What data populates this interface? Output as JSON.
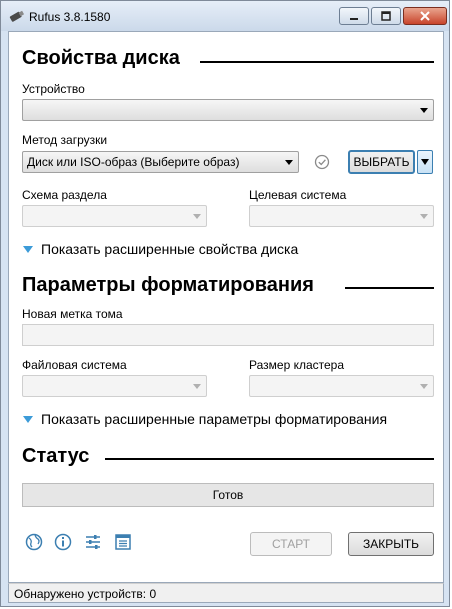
{
  "window": {
    "title": "Rufus 3.8.1580"
  },
  "drive_properties": {
    "heading": "Свойства диска",
    "device_label": "Устройство",
    "device_value": "",
    "boot_method_label": "Метод загрузки",
    "boot_method_value": "Диск или ISO-образ (Выберите образ)",
    "select_button": "ВЫБРАТЬ",
    "partition_scheme_label": "Схема раздела",
    "target_system_label": "Целевая система",
    "advanced_toggle": "Показать расширенные свойства диска"
  },
  "format_options": {
    "heading": "Параметры форматирования",
    "volume_label_label": "Новая метка тома",
    "volume_label_value": "",
    "filesystem_label": "Файловая система",
    "cluster_size_label": "Размер кластера",
    "advanced_toggle": "Показать расширенные параметры форматирования"
  },
  "status": {
    "heading": "Статус",
    "progress_text": "Готов",
    "progress_fraction": 0
  },
  "actions": {
    "start_button": "СТАРТ",
    "close_button": "ЗАКРЫТЬ"
  },
  "status_bar": {
    "text": "Обнаружено устройств: 0"
  },
  "icons": [
    "globe-icon",
    "info-icon",
    "settings-sliders-icon",
    "log-icon"
  ],
  "colors": {
    "accent": "#3c9bd8",
    "focus_border": "#3c7fb1",
    "close_red": "#c8442b"
  }
}
